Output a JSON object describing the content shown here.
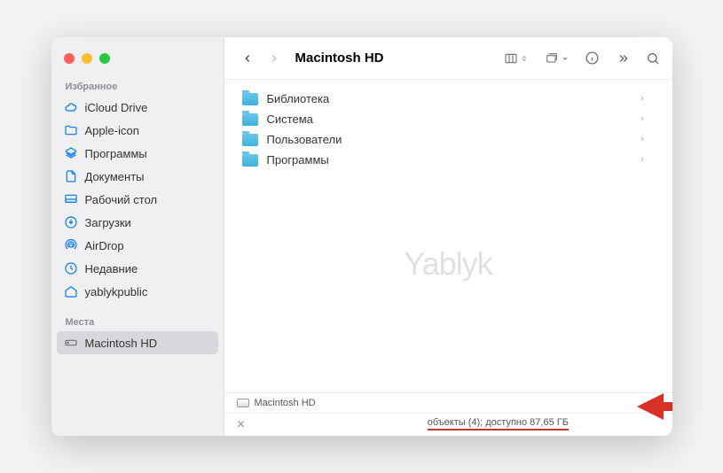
{
  "window": {
    "title": "Macintosh HD"
  },
  "watermark": "Yablyk",
  "sidebar": {
    "favorites_label": "Избранное",
    "locations_label": "Места",
    "items": [
      {
        "label": "iCloud Drive",
        "icon": "cloud"
      },
      {
        "label": "Apple-icon",
        "icon": "folder-outline"
      },
      {
        "label": "Программы",
        "icon": "apps"
      },
      {
        "label": "Документы",
        "icon": "doc"
      },
      {
        "label": "Рабочий стол",
        "icon": "desktop"
      },
      {
        "label": "Загрузки",
        "icon": "download"
      },
      {
        "label": "AirDrop",
        "icon": "airdrop"
      },
      {
        "label": "Недавние",
        "icon": "clock"
      },
      {
        "label": "yablykpublic",
        "icon": "home"
      }
    ],
    "locations": [
      {
        "label": "Macintosh HD",
        "icon": "hd",
        "selected": true
      }
    ]
  },
  "files": [
    {
      "label": "Библиотека"
    },
    {
      "label": "Система"
    },
    {
      "label": "Пользователи"
    },
    {
      "label": "Программы"
    }
  ],
  "path": {
    "label": "Macintosh HD"
  },
  "status": {
    "text": "объекты (4); доступно 87,65 ГБ"
  }
}
